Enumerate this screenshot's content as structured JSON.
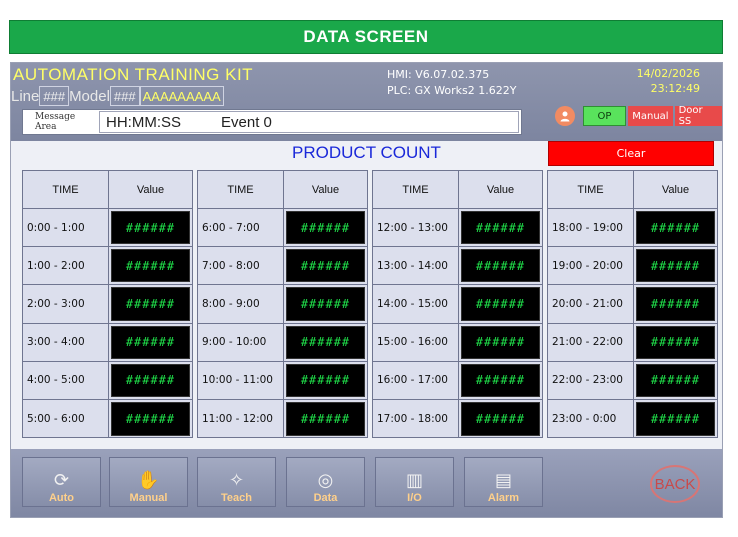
{
  "banner": {
    "title": "DATA SCREEN"
  },
  "header": {
    "kit_title": "AUTOMATION TRAINING KIT",
    "line_label": "Line",
    "line_value": "###",
    "model_label": "Model",
    "model_value": "###",
    "model_name": "AAAAAAAAA",
    "hmi_version": "HMI: V6.07.02.375",
    "plc_version": "PLC: GX Works2 1.622Y",
    "date": "14/02/2026",
    "time": "23:12:49"
  },
  "message_area": {
    "label": "Message Area",
    "time_text": "HH:MM:SS",
    "event_text": "Event 0"
  },
  "status": {
    "user_icon": "user-icon",
    "op_label": "OP",
    "manual_label": "Manual",
    "door_label": "Door SS",
    "colors": {
      "op": "#59e25c",
      "alarm": "#e84a4a"
    }
  },
  "product_count": {
    "title": "PRODUCT COUNT",
    "clear_label": "Clear",
    "col_time": "TIME",
    "col_value": "Value",
    "tables": [
      {
        "rows": [
          {
            "time": "0:00 - 1:00",
            "value": "######"
          },
          {
            "time": "1:00 - 2:00",
            "value": "######"
          },
          {
            "time": "2:00 - 3:00",
            "value": "######"
          },
          {
            "time": "3:00 - 4:00",
            "value": "######"
          },
          {
            "time": "4:00 - 5:00",
            "value": "######"
          },
          {
            "time": "5:00 - 6:00",
            "value": "######"
          }
        ]
      },
      {
        "rows": [
          {
            "time": "6:00 - 7:00",
            "value": "######"
          },
          {
            "time": "7:00 - 8:00",
            "value": "######"
          },
          {
            "time": "8:00 - 9:00",
            "value": "######"
          },
          {
            "time": "9:00 - 10:00",
            "value": "######"
          },
          {
            "time": "10:00 - 11:00",
            "value": "######"
          },
          {
            "time": "11:00 - 12:00",
            "value": "######"
          }
        ]
      },
      {
        "rows": [
          {
            "time": "12:00 - 13:00",
            "value": "######"
          },
          {
            "time": "13:00 - 14:00",
            "value": "######"
          },
          {
            "time": "14:00 - 15:00",
            "value": "######"
          },
          {
            "time": "15:00 - 16:00",
            "value": "######"
          },
          {
            "time": "16:00 - 17:00",
            "value": "######"
          },
          {
            "time": "17:00 - 18:00",
            "value": "######"
          }
        ]
      },
      {
        "rows": [
          {
            "time": "18:00 - 19:00",
            "value": "######"
          },
          {
            "time": "19:00 - 20:00",
            "value": "######"
          },
          {
            "time": "20:00 - 21:00",
            "value": "######"
          },
          {
            "time": "21:00 - 22:00",
            "value": "######"
          },
          {
            "time": "22:00 - 23:00",
            "value": "######"
          },
          {
            "time": "23:00 - 0:00",
            "value": "######"
          }
        ]
      }
    ]
  },
  "footer": {
    "buttons": [
      {
        "label": "Auto",
        "icon": "refresh-icon"
      },
      {
        "label": "Manual",
        "icon": "hand-icon"
      },
      {
        "label": "Teach",
        "icon": "wand-icon"
      },
      {
        "label": "Data",
        "icon": "data-ring-icon"
      },
      {
        "label": "I/O",
        "icon": "io-icon"
      },
      {
        "label": "Alarm",
        "icon": "alarm-icon"
      }
    ],
    "back_label": "BACK"
  }
}
